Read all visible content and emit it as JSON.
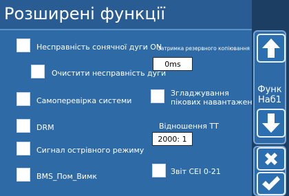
{
  "screen": {
    "title": "Розширені функції"
  },
  "options": {
    "solar_arc_fault": "Несправність сонячної дуги ON",
    "clear_arc_fault": "Очистити несправність дуги",
    "system_self_check": "Самоперевірка системи",
    "drm": "DRM",
    "island_mode_signal": "Сигнал острівного режиму",
    "bms_err_stop": "BMS_Пом_Вимк",
    "backup_delay_label": "Затримка резервного копіювання",
    "backup_delay_value": "0ms",
    "peak_shaving_line1": "Згладжування",
    "peak_shaving_line2": "пікових навантажень",
    "ct_ratio_label": "Відношення ТТ",
    "ct_ratio_value": "2000: 1",
    "cei_report": "Звіт CEI 0-21"
  },
  "sidebar": {
    "func_line1": "Функ",
    "func_line2": "Наб1"
  },
  "colors": {
    "background": "#1c3e63",
    "panel": "#2d6aa6",
    "titlebar": "#2a5c94",
    "button_blue": "#2b6fb0",
    "white": "#ffffff"
  }
}
